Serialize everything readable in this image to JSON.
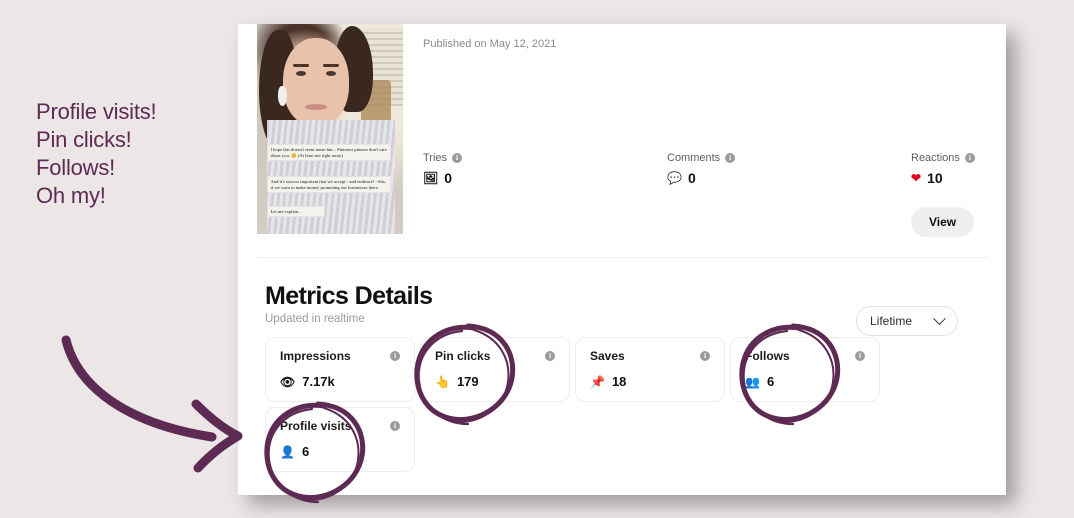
{
  "annotation": {
    "lines": [
      "Profile visits!",
      "Pin clicks!",
      "Follows!",
      "Oh my!"
    ],
    "ink_color": "#5d2a53",
    "background_color": "#ece6e7",
    "arrow": "curved-arrow-pointing-right",
    "circles": [
      "pin-clicks",
      "follows",
      "profile-visits"
    ]
  },
  "pin": {
    "published": "Published on May 12, 2021",
    "thumbnail_alt": "pin-thumbnail-woman-selfie",
    "overlay_text": [
      "I hope this doesn't seem mean but... Pinterest pinners don't care about you. 😊 (At least not right away)",
      "And it's sooooo important that we accept - and embrace! - this, if we want to make money promoting our businesses there.",
      "Let me explain..."
    ],
    "stats": [
      {
        "label": "Tries",
        "icon": "image-icon",
        "glyph": "🖼",
        "value": "0"
      },
      {
        "label": "Comments",
        "icon": "comment-bubble-icon",
        "glyph": "💬",
        "value": "0"
      },
      {
        "label": "Reactions",
        "icon": "heart-icon",
        "glyph": "❤",
        "value": "10"
      }
    ],
    "view_button": "View"
  },
  "metrics": {
    "title": "Metrics Details",
    "subtitle": "Updated in realtime",
    "range_selected": "Lifetime",
    "range_icon": "chevron-down-icon",
    "info_glyph": "i",
    "cards": [
      {
        "name": "Impressions",
        "icon": "eye-icon",
        "glyph": "👁",
        "value": "7.17k"
      },
      {
        "name": "Pin clicks",
        "icon": "pointing-hand-icon",
        "glyph": "👆",
        "value": "179"
      },
      {
        "name": "Saves",
        "icon": "pin-icon",
        "glyph": "📌",
        "value": "18"
      },
      {
        "name": "Follows",
        "icon": "people-icon",
        "glyph": "👥",
        "value": "6"
      },
      {
        "name": "Profile visits",
        "icon": "person-icon",
        "glyph": "👤",
        "value": "6"
      }
    ]
  }
}
